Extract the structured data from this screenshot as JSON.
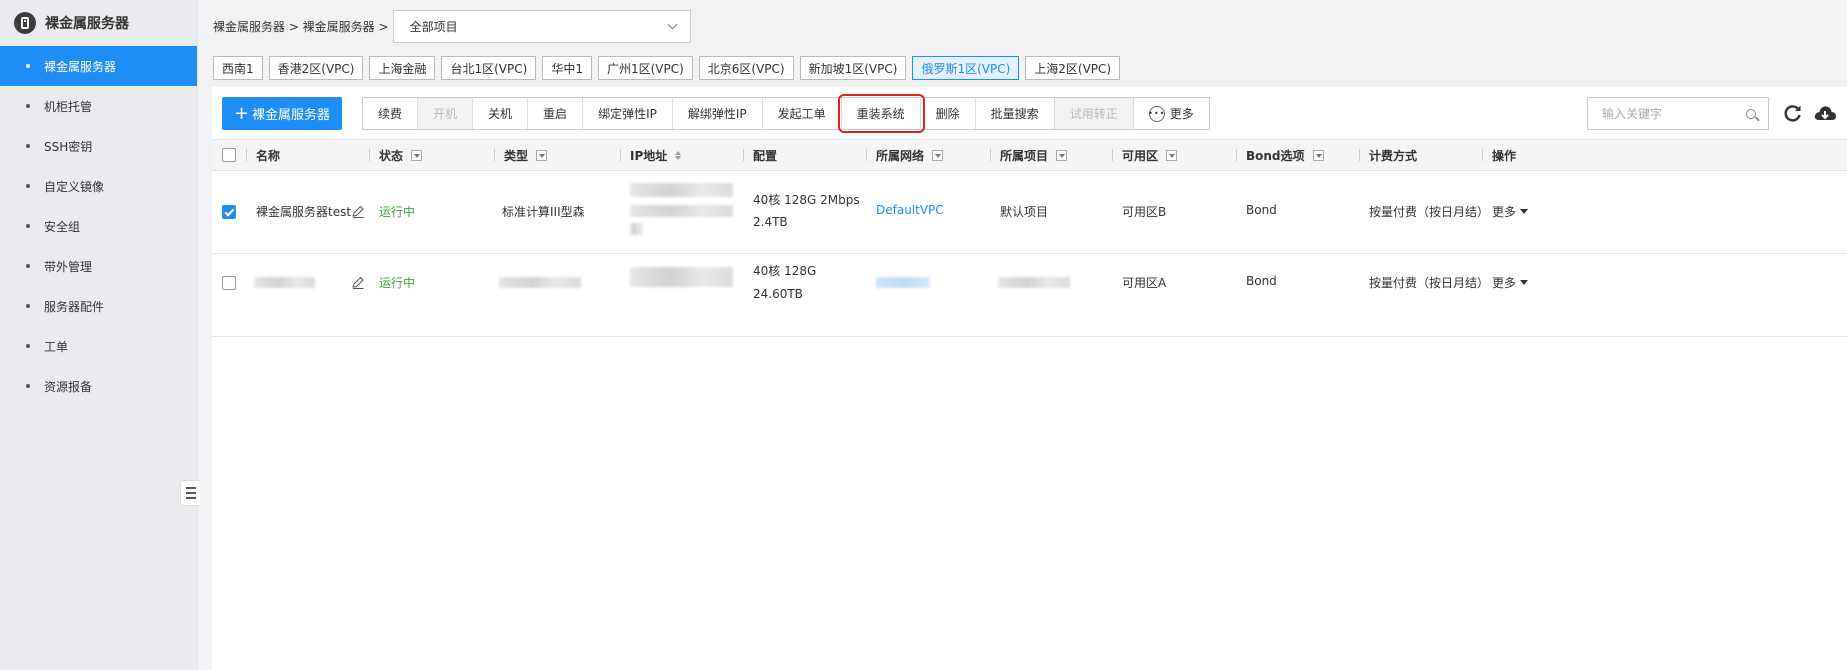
{
  "sidebar": {
    "title": "裸金属服务器",
    "items": [
      {
        "label": "裸金属服务器",
        "active": true
      },
      {
        "label": "机柜托管"
      },
      {
        "label": "SSH密钥"
      },
      {
        "label": "自定义镜像"
      },
      {
        "label": "安全组"
      },
      {
        "label": "带外管理"
      },
      {
        "label": "服务器配件"
      },
      {
        "label": "工单"
      },
      {
        "label": "资源报备"
      }
    ]
  },
  "header": {
    "breadcrumb": "裸金属服务器 > 裸金属服务器 >",
    "project_select": "全部项目"
  },
  "regions": [
    "西南1",
    "香港2区(VPC)",
    "上海金融",
    "台北1区(VPC)",
    "华中1",
    "广州1区(VPC)",
    "北京6区(VPC)",
    "新加坡1区(VPC)",
    "俄罗斯1区(VPC)",
    "上海2区(VPC)"
  ],
  "active_region": "俄罗斯1区(VPC)",
  "toolbar": {
    "create_label": "裸金属服务器",
    "buttons": [
      {
        "label": "续费"
      },
      {
        "label": "开机",
        "disabled": true
      },
      {
        "label": "关机"
      },
      {
        "label": "重启"
      },
      {
        "label": "绑定弹性IP"
      },
      {
        "label": "解绑弹性IP"
      },
      {
        "label": "发起工单"
      },
      {
        "label": "重装系统",
        "highlighted": true
      },
      {
        "label": "删除"
      },
      {
        "label": "批量搜索"
      },
      {
        "label": "试用转正",
        "disabled": true
      },
      {
        "label": "更多"
      }
    ],
    "search_placeholder": "输入关键字"
  },
  "table": {
    "columns": [
      "名称",
      "状态",
      "类型",
      "IP地址",
      "配置",
      "所属网络",
      "所属项目",
      "可用区",
      "Bond选项",
      "计费方式",
      "操作"
    ],
    "rows": [
      {
        "checked": true,
        "name": "裸金属服务器test",
        "status": "运行中",
        "type": "标准计算III型森",
        "config_line1": "40核 128G 2Mbps",
        "config_line2": "2.4TB",
        "network": "DefaultVPC",
        "project": "默认项目",
        "zone": "可用区B",
        "bond": "Bond",
        "billing": "按量付费（按日月结）",
        "action": "更多"
      },
      {
        "checked": false,
        "name": "",
        "status": "运行中",
        "type": "",
        "config_line1": "40核 128G",
        "config_line2": "24.60TB",
        "network": "",
        "project": "",
        "zone": "可用区A",
        "bond": "Bond",
        "billing": "按量付费（按日月结）",
        "action": "更多"
      }
    ]
  },
  "colors": {
    "accent": "#1e8ef4",
    "running": "#3aa53a",
    "highlight_outline": "#e0241c"
  }
}
